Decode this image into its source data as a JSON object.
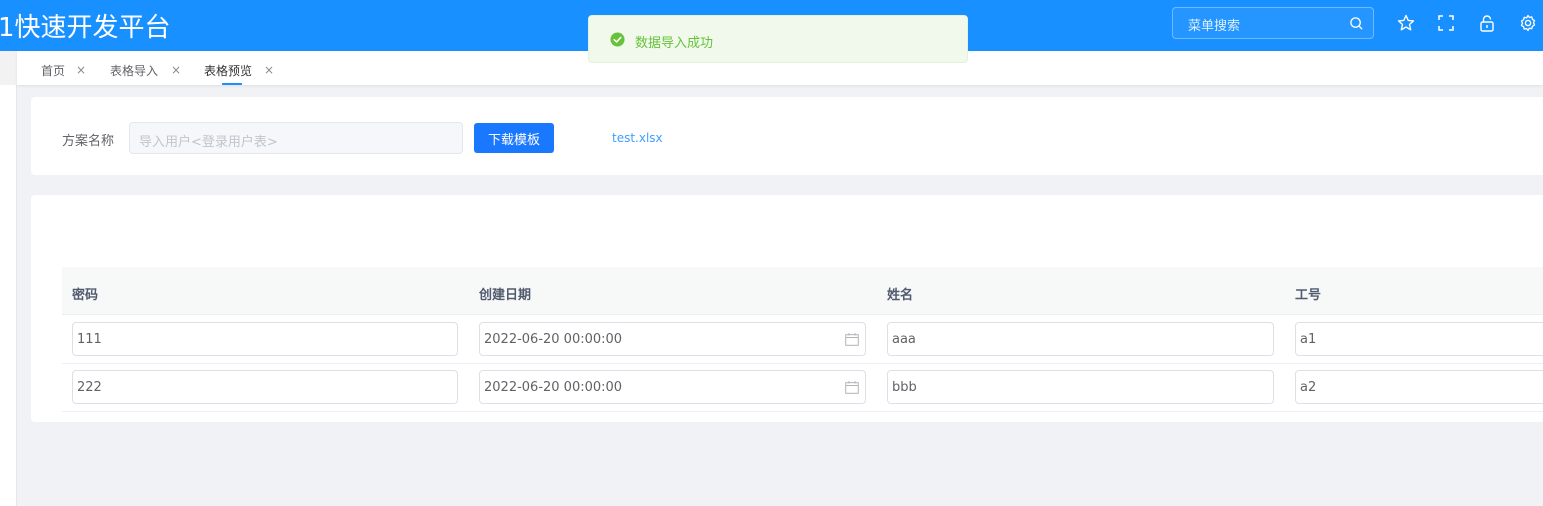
{
  "header": {
    "app_title": "1快速开发平台",
    "search_placeholder": "菜单搜索"
  },
  "tabs": [
    {
      "label": "首页",
      "close": "×"
    },
    {
      "label": "表格导入",
      "close": "×"
    },
    {
      "label": "表格预览",
      "close": "×",
      "active": true
    }
  ],
  "toast": {
    "message": "数据导入成功"
  },
  "form": {
    "scheme_label": "方案名称",
    "scheme_value": "导入用户<登录用户表>",
    "download_button": "下载模板",
    "file_name": "test.xlsx"
  },
  "table": {
    "headers": [
      "密码",
      "创建日期",
      "姓名",
      "工号"
    ],
    "rows": [
      {
        "password": "111",
        "created": "2022-06-20 00:00:00",
        "name": "aaa",
        "emp_no": "a1"
      },
      {
        "password": "222",
        "created": "2022-06-20 00:00:00",
        "name": "bbb",
        "emp_no": "a2"
      }
    ]
  },
  "colors": {
    "header_bg": "#1890ff",
    "primary": "#1a78ff",
    "success": "#67c23a",
    "link": "#409eff"
  },
  "icons": [
    "search-icon",
    "star-icon",
    "fullscreen-icon",
    "lock-icon",
    "gear-icon",
    "check-circle-icon",
    "calendar-icon",
    "close-icon"
  ]
}
